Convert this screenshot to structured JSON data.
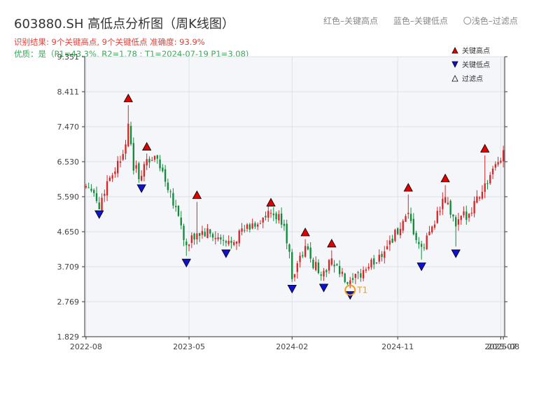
{
  "header": {
    "title": "603880.SH 高低点分析图（周K线图）",
    "result_line": "识别结果: 9个关键高点, 9个关键低点  准确度: 93.9%",
    "quality_line": "优质：是（P1=43.3%, R2=1.78 ; T1=2024-07-19 P1=3.08)"
  },
  "top_legend": {
    "red": "红色–关键高点",
    "blue": "蓝色–关键低点",
    "light": "〇浅色–过滤点"
  },
  "colors": {
    "up": "#d62728",
    "down": "#108c3a",
    "high_marker": "#e00000",
    "low_marker": "#1010d0",
    "filtered_marker": "#ffffff",
    "t1_ring": "#f39c12",
    "plot_bg": "#f4f6f9",
    "grid": "#dde2ea"
  },
  "chart_data": {
    "type": "candlestick",
    "title": "603880.SH 高低点分析图（周K线图）",
    "y_ticks": [
      1.829,
      2.769,
      3.709,
      4.65,
      5.59,
      6.53,
      7.47,
      8.411,
      9.351
    ],
    "y_tick_labels": [
      "1.829",
      "2.769",
      "3.709",
      "4.650",
      "5.590",
      "6.530",
      "7.470",
      "8.411",
      "9.351"
    ],
    "ylim": [
      1.829,
      9.351
    ],
    "x_tick_labels": [
      "2022-08",
      "2023-05",
      "2024-02",
      "2024-11",
      "2025-07",
      "2025-08"
    ],
    "x_tick_index": [
      0,
      39,
      78,
      118,
      157,
      158
    ],
    "bar_count": 159,
    "grid": true,
    "legend": {
      "position": "top-right",
      "entries": [
        {
          "label": "关键高点",
          "marker": "triangle-up",
          "color": "#e00000"
        },
        {
          "label": "关键低点",
          "marker": "triangle-down",
          "color": "#1010d0"
        },
        {
          "label": "过滤点",
          "marker": "triangle-up-hollow",
          "color": "#ffffff"
        }
      ]
    },
    "key_highs": [
      {
        "index": 16,
        "value": 8.1
      },
      {
        "index": 23,
        "value": 6.8
      },
      {
        "index": 42,
        "value": 5.5
      },
      {
        "index": 70,
        "value": 5.3
      },
      {
        "index": 83,
        "value": 4.5
      },
      {
        "index": 93,
        "value": 4.2
      },
      {
        "index": 122,
        "value": 5.7
      },
      {
        "index": 136,
        "value": 5.95
      },
      {
        "index": 151,
        "value": 6.75
      }
    ],
    "key_lows": [
      {
        "index": 5,
        "value": 5.25
      },
      {
        "index": 21,
        "value": 5.95
      },
      {
        "index": 38,
        "value": 3.95
      },
      {
        "index": 53,
        "value": 4.2
      },
      {
        "index": 78,
        "value": 3.25
      },
      {
        "index": 90,
        "value": 3.28
      },
      {
        "index": 100,
        "value": 3.08
      },
      {
        "index": 127,
        "value": 3.85
      },
      {
        "index": 140,
        "value": 4.2
      }
    ],
    "t1": {
      "index": 100,
      "value": 3.08,
      "label": "T1"
    },
    "candles_source": "weekly OHLC reconstructed from anchors",
    "anchors": [
      {
        "index": 0,
        "value": 5.9
      },
      {
        "index": 2,
        "value": 5.9
      },
      {
        "index": 5,
        "value": 5.3
      },
      {
        "index": 8,
        "value": 6.0
      },
      {
        "index": 13,
        "value": 6.6
      },
      {
        "index": 16,
        "value": 7.4
      },
      {
        "index": 18,
        "value": 6.4
      },
      {
        "index": 21,
        "value": 6.1
      },
      {
        "index": 23,
        "value": 6.6
      },
      {
        "index": 27,
        "value": 6.6
      },
      {
        "index": 31,
        "value": 5.9
      },
      {
        "index": 35,
        "value": 5.1
      },
      {
        "index": 38,
        "value": 4.2
      },
      {
        "index": 42,
        "value": 4.6
      },
      {
        "index": 46,
        "value": 4.6
      },
      {
        "index": 53,
        "value": 4.3
      },
      {
        "index": 58,
        "value": 4.6
      },
      {
        "index": 65,
        "value": 4.9
      },
      {
        "index": 70,
        "value": 5.1
      },
      {
        "index": 75,
        "value": 4.9
      },
      {
        "index": 78,
        "value": 3.5
      },
      {
        "index": 83,
        "value": 4.2
      },
      {
        "index": 87,
        "value": 3.7
      },
      {
        "index": 90,
        "value": 3.5
      },
      {
        "index": 93,
        "value": 3.9
      },
      {
        "index": 98,
        "value": 3.3
      },
      {
        "index": 100,
        "value": 3.2
      },
      {
        "index": 105,
        "value": 3.6
      },
      {
        "index": 110,
        "value": 3.9
      },
      {
        "index": 115,
        "value": 4.4
      },
      {
        "index": 122,
        "value": 5.0
      },
      {
        "index": 127,
        "value": 4.1
      },
      {
        "index": 132,
        "value": 5.0
      },
      {
        "index": 136,
        "value": 5.5
      },
      {
        "index": 140,
        "value": 4.8
      },
      {
        "index": 145,
        "value": 5.2
      },
      {
        "index": 151,
        "value": 5.9
      },
      {
        "index": 154,
        "value": 6.2
      },
      {
        "index": 158,
        "value": 6.8
      }
    ]
  }
}
